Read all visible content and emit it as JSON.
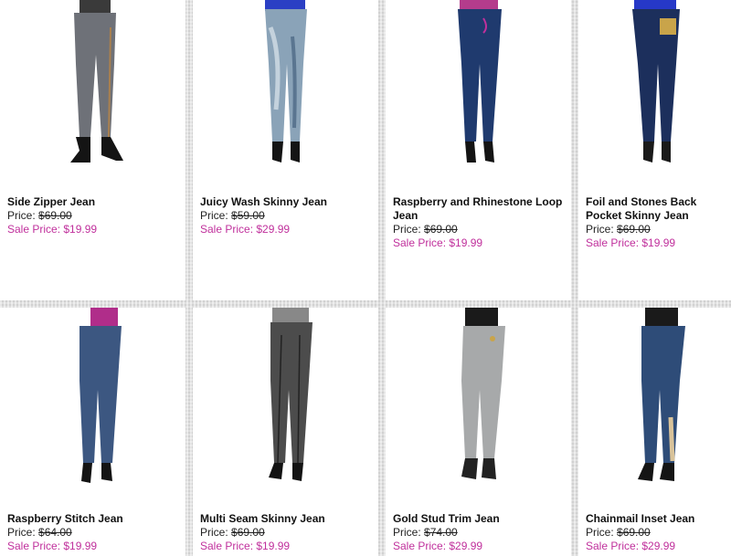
{
  "products": [
    {
      "name": "Side Zipper Jean",
      "price_label": "Price:",
      "original_price": "$69.00",
      "sale_label": "Sale Price:",
      "sale_price": "$19.99",
      "image": "jeans-photo-gray-side-zipper"
    },
    {
      "name": "Juicy Wash Skinny Jean",
      "price_label": "Price:",
      "original_price": "$59.00",
      "sale_label": "Sale Price:",
      "sale_price": "$29.99",
      "image": "jeans-photo-acid-wash"
    },
    {
      "name": "Raspberry and Rhinestone Loop Jean",
      "price_label": "Price:",
      "original_price": "$69.00",
      "sale_label": "Sale Price:",
      "sale_price": "$19.99",
      "image": "jeans-photo-dark-blue"
    },
    {
      "name": "Foil and Stones Back Pocket Skinny Jean",
      "price_label": "Price:",
      "original_price": "$69.00",
      "sale_label": "Sale Price:",
      "sale_price": "$19.99",
      "image": "jeans-photo-dark-blue-gold-pocket"
    },
    {
      "name": "Raspberry Stitch Jean",
      "price_label": "Price:",
      "original_price": "$64.00",
      "sale_label": "Sale Price:",
      "sale_price": "$19.99",
      "image": "jeans-photo-medium-blue"
    },
    {
      "name": "Multi Seam Skinny Jean",
      "price_label": "Price:",
      "original_price": "$69.00",
      "sale_label": "Sale Price:",
      "sale_price": "$19.99",
      "image": "jeans-photo-gray-seams"
    },
    {
      "name": "Gold Stud Trim Jean",
      "price_label": "Price:",
      "original_price": "$74.00",
      "sale_label": "Sale Price:",
      "sale_price": "$29.99",
      "image": "jeans-photo-light-acid-wash"
    },
    {
      "name": "Chainmail Inset Jean",
      "price_label": "Price:",
      "original_price": "$69.00",
      "sale_label": "Sale Price:",
      "sale_price": "$29.99",
      "image": "jeans-photo-blue-chainmail"
    }
  ],
  "colors": {
    "sale_price": "#c0309c",
    "background": "#dcdcdc",
    "card": "#ffffff"
  }
}
